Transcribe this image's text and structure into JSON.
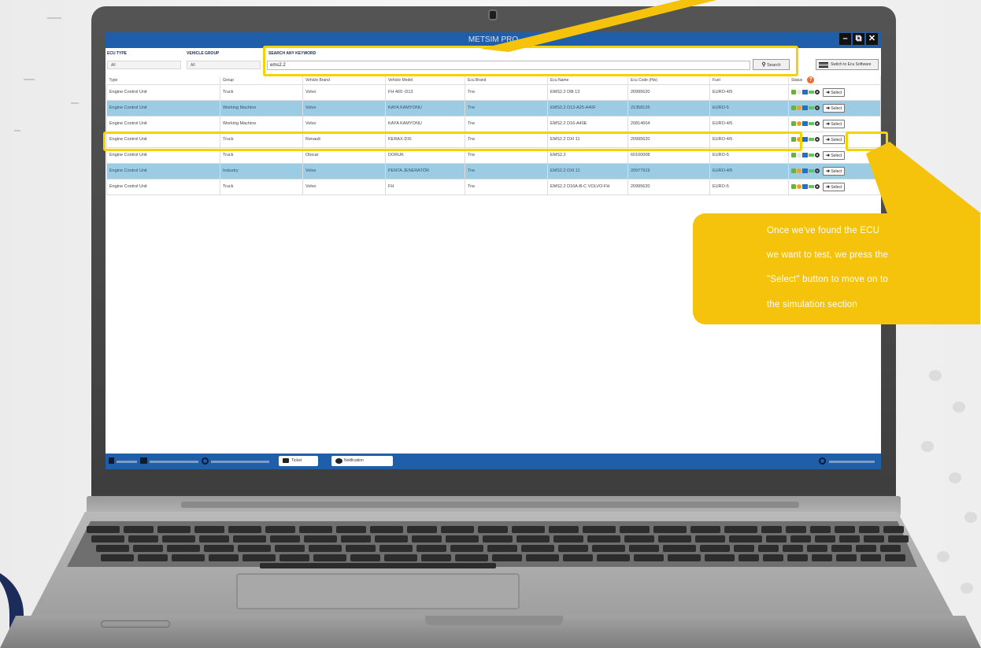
{
  "app": {
    "title": "METSIM PRO",
    "window_controls": [
      "minimize",
      "restore",
      "close"
    ]
  },
  "filters": {
    "ecu_type_label": "ECU TYPE",
    "ecu_type_value": "All",
    "vehicle_group_label": "VEHICLE GROUP",
    "vehicle_group_value": "All",
    "search_label": "SEARCH ANY KEYWORD",
    "search_value": "ems2.2",
    "search_button": "Search",
    "switch_button": "Switch to Ecu Software"
  },
  "table": {
    "columns": [
      "Type",
      "Group",
      "Vehicle Brand",
      "Vehicle Model",
      "Ecu Brand",
      "Ecu Name",
      "Ecu Code (Hw)",
      "Fuel",
      "Status"
    ],
    "select_label": "Select",
    "rows": [
      {
        "type": "Engine Control Unit",
        "group": "Truck",
        "brand": "Volvo",
        "model": "FH 460 -D13",
        "ecu_brand": "Trw",
        "ecu_name": "EMS2.2 D8t 13",
        "code": "20995620",
        "fuel": "EURO-4/5",
        "highlighted": false
      },
      {
        "type": "Engine Control Unit",
        "group": "Working Machine",
        "brand": "Volvo",
        "model": "KAYA KAMYONU",
        "ecu_brand": "Trw",
        "ecu_name": "EMS2.2 D13-A25-A40F",
        "code": "21358126",
        "fuel": "EURO-5",
        "highlighted": true
      },
      {
        "type": "Engine Control Unit",
        "group": "Working Machine",
        "brand": "Volvo",
        "model": "KAYA KAMYONU",
        "ecu_brand": "Trw",
        "ecu_name": "EMS2.2 D16-A40E",
        "code": "20814604",
        "fuel": "EURO-4/5",
        "highlighted": false
      },
      {
        "type": "Engine Control Unit",
        "group": "Truck",
        "brand": "Renault",
        "model": "KERAX-DXI",
        "ecu_brand": "Trw",
        "ecu_name": "EMS2.2 DXI 11",
        "code": "20995620",
        "fuel": "EURO-4/5",
        "highlighted": false
      },
      {
        "type": "Engine Control Unit",
        "group": "Truck",
        "brand": "Otocar",
        "model": "DORUK",
        "ecu_brand": "Trw",
        "ecu_name": "EMS2.2",
        "code": "60100008",
        "fuel": "EURO-5",
        "highlighted": false
      },
      {
        "type": "Engine Control Unit",
        "group": "Industry",
        "brand": "Volvo",
        "model": "PENTA JENERATÖR",
        "ecu_brand": "Trw",
        "ecu_name": "EMS2.2 DXI 11",
        "code": "20977919",
        "fuel": "EURO-4/5",
        "highlighted": true
      },
      {
        "type": "Engine Control Unit",
        "group": "Truck",
        "brand": "Volvo",
        "model": "FH",
        "ecu_brand": "Trw",
        "ecu_name": "EMS2.2 D16A-B-C VOLVO-FH",
        "code": "20995620",
        "fuel": "EURO-5",
        "highlighted": false
      }
    ]
  },
  "statusbar": {
    "ticket_button": "Ticket",
    "notification_button": "Notification"
  },
  "callout": {
    "lines": [
      "Once we've found the ECU",
      "we want to test, we press the",
      "\"Select\" button to move on to",
      "the simulation section"
    ]
  },
  "colors": {
    "app_blue": "#1f5ea8",
    "row_highlight": "#9ccbe4",
    "highlight_yellow": "#f3d400",
    "callout_yellow": "#f5c30b"
  }
}
